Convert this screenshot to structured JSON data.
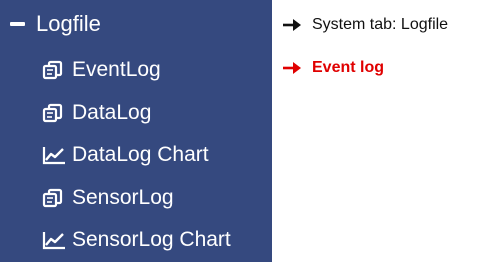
{
  "sidebar": {
    "header": {
      "label": "Logfile",
      "icon": "minus-icon"
    },
    "items": [
      {
        "label": "EventLog",
        "icon": "log-icon"
      },
      {
        "label": "DataLog",
        "icon": "log-icon"
      },
      {
        "label": "DataLog Chart",
        "icon": "chart-icon"
      },
      {
        "label": "SensorLog",
        "icon": "log-icon"
      },
      {
        "label": "SensorLog Chart",
        "icon": "chart-icon"
      }
    ],
    "background": "#35497f",
    "text_color": "#ffffff"
  },
  "annotations": [
    {
      "text": "System tab: Logfile",
      "color": "#111111",
      "arrow": "arrow-right-icon"
    },
    {
      "text": "Event log",
      "color": "#e00000",
      "arrow": "arrow-right-icon"
    }
  ]
}
